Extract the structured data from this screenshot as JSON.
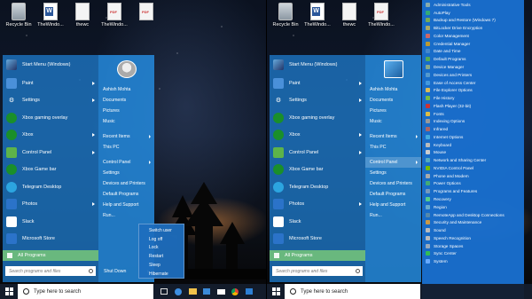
{
  "desktop": {
    "icons": [
      {
        "label": "Recycle Bin",
        "icon": "recycle-bin-icon"
      },
      {
        "label": "TheWindo...",
        "icon": "word-doc-icon"
      },
      {
        "label": "thewc",
        "icon": "document-icon"
      },
      {
        "label": "TheWindo...",
        "icon": "pdf-icon"
      },
      {
        "label": "",
        "icon": "pdf-icon"
      }
    ],
    "icons_right": [
      {
        "label": "Recycle Bin",
        "icon": "recycle-bin-icon"
      },
      {
        "label": "TheWindo...",
        "icon": "word-doc-icon"
      },
      {
        "label": "thewc",
        "icon": "document-icon"
      },
      {
        "label": "TheWindo...",
        "icon": "pdf-icon"
      }
    ]
  },
  "start_menu": {
    "title": "Start Menu (Windows)",
    "apps": [
      {
        "name": "Paint",
        "icon": "paint-icon",
        "submenu": true
      },
      {
        "name": "Settings",
        "icon": "settings-icon",
        "submenu": true
      },
      {
        "name": "Xbox gaming overlay",
        "icon": "xbox-icon",
        "submenu": false
      },
      {
        "name": "Xbox",
        "icon": "xbox-icon",
        "submenu": true
      },
      {
        "name": "Control Panel",
        "icon": "control-panel-icon",
        "submenu": true
      },
      {
        "name": "Xbox Game bar",
        "icon": "xbox-icon",
        "submenu": false
      },
      {
        "name": "Telegram Desktop",
        "icon": "telegram-icon",
        "submenu": false
      },
      {
        "name": "Photos",
        "icon": "photos-icon",
        "submenu": true
      },
      {
        "name": "Slack",
        "icon": "slack-icon",
        "submenu": false
      },
      {
        "name": "Microsoft Store",
        "icon": "store-icon",
        "submenu": false
      }
    ],
    "all_programs": "All Programs",
    "search_placeholder": "Search programs and files",
    "right_items": [
      {
        "label": "Ashish Mohta",
        "arrow": false,
        "gap": false
      },
      {
        "label": "Documents",
        "arrow": false,
        "gap": false
      },
      {
        "label": "Pictures",
        "arrow": false,
        "gap": false
      },
      {
        "label": "Music",
        "arrow": false,
        "gap": false
      },
      {
        "label": "Recent Items",
        "arrow": true,
        "gap": true
      },
      {
        "label": "This PC",
        "arrow": false,
        "gap": false
      },
      {
        "label": "Control Panel",
        "arrow": true,
        "gap": true
      },
      {
        "label": "Settings",
        "arrow": false,
        "gap": false
      },
      {
        "label": "Devices and Printers",
        "arrow": false,
        "gap": false
      },
      {
        "label": "Default Programs",
        "arrow": false,
        "gap": false
      },
      {
        "label": "Help and Support",
        "arrow": false,
        "gap": false
      },
      {
        "label": "Run...",
        "arrow": false,
        "gap": false
      }
    ],
    "shutdown": "Shut Down"
  },
  "power_menu": [
    "Switch user",
    "Log off",
    "Lock",
    "Restart",
    "Sleep",
    "Hibernate"
  ],
  "control_panel_menu": [
    "Administrative Tools",
    "AutoPlay",
    "Backup and Restore (Windows 7)",
    "BitLocker Drive Encryption",
    "Color Management",
    "Credential Manager",
    "Date and Time",
    "Default Programs",
    "Device Manager",
    "Devices and Printers",
    "Ease of Access Center",
    "File Explorer Options",
    "File History",
    "Flash Player (32-bit)",
    "Fonts",
    "Indexing Options",
    "Infrared",
    "Internet Options",
    "Keyboard",
    "Mouse",
    "Network and Sharing Center",
    "NVIDIA Control Panel",
    "Phone and Modem",
    "Power Options",
    "Programs and Features",
    "Recovery",
    "Region",
    "RemoteApp and Desktop Connections",
    "Security and Maintenance",
    "Sound",
    "Speech Recognition",
    "Storage Spaces",
    "Sync Center",
    "System"
  ],
  "control_panel_icon_colors": [
    "#8aa",
    "#3a7",
    "#7a5",
    "#aa6",
    "#c66",
    "#b93",
    "#48c",
    "#5a5",
    "#8a8",
    "#59c",
    "#49d",
    "#db5",
    "#7b4",
    "#c33",
    "#db4",
    "#999",
    "#a66",
    "#4ad",
    "#bbb",
    "#ccc",
    "#5ab",
    "#7b0",
    "#aaa",
    "#4a7",
    "#79b",
    "#5c8",
    "#6ac",
    "#58a",
    "#c94",
    "#bbb",
    "#bbb",
    "#9ab",
    "#3b5",
    "#6af"
  ],
  "taskbar": {
    "search_placeholder": "Type here to search",
    "apps": [
      "task-view-icon",
      "edge-icon",
      "file-explorer-icon",
      "store-icon",
      "mail-icon",
      "chrome-icon",
      "photos-icon"
    ]
  }
}
